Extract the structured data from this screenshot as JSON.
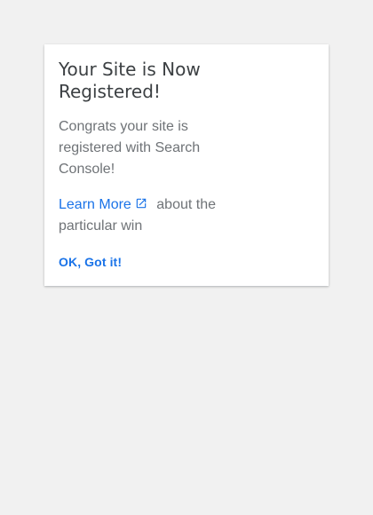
{
  "dialog": {
    "title": "Your Site is Now Registered!",
    "message": "Congrats your site is registered with Search Console!",
    "learn_more_label": "Learn More",
    "learn_more_icon": "external-link-icon",
    "learn_more_suffix": "about the particular win",
    "ok_button_label": "OK, Got it!"
  },
  "colors": {
    "background": "#f1f1f1",
    "card": "#ffffff",
    "title": "#3c4043",
    "body_text": "#6f7377",
    "accent": "#1a73e8"
  }
}
